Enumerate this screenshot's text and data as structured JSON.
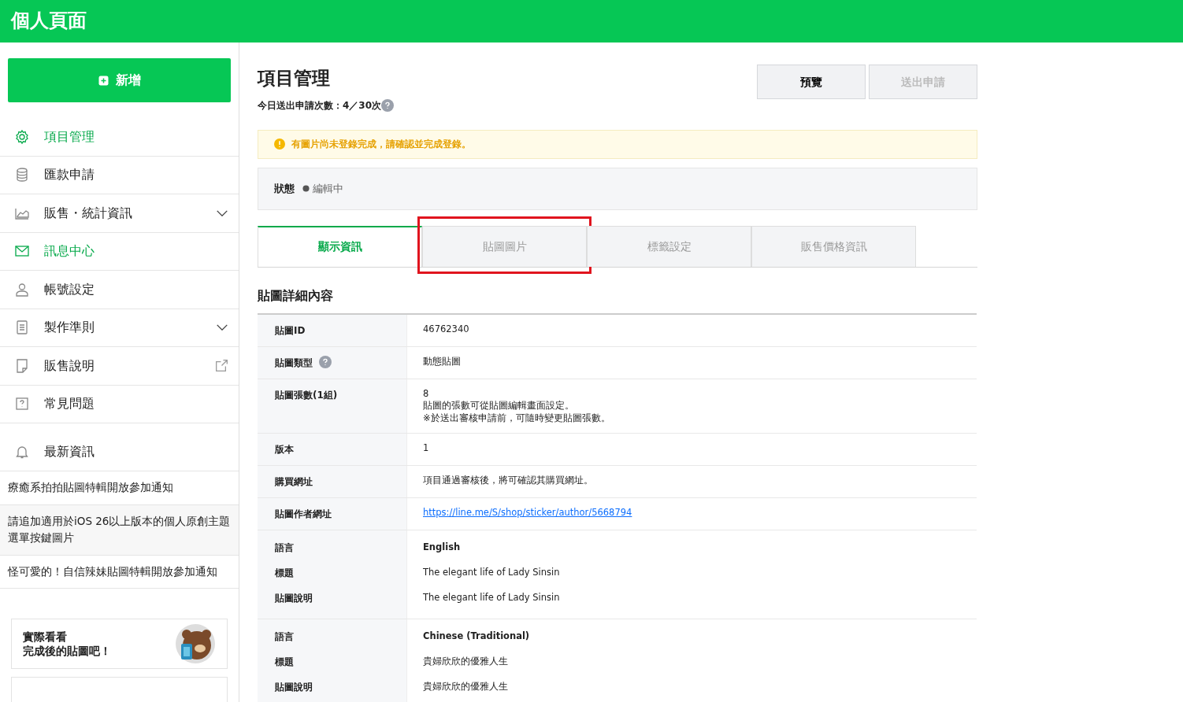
{
  "header": {
    "title": "個人頁面"
  },
  "sidebar": {
    "new_button": "新增",
    "items": [
      {
        "kind": "plain",
        "label": "項目管理",
        "highlighted": true
      },
      {
        "kind": "plain",
        "label": "匯款申請",
        "highlighted": false
      },
      {
        "kind": "expandable",
        "label": "販售・統計資訊",
        "highlighted": false
      },
      {
        "kind": "plain",
        "label": "訊息中心",
        "highlighted": true
      },
      {
        "kind": "plain",
        "label": "帳號設定",
        "highlighted": false
      },
      {
        "kind": "expandable",
        "label": "製作準則",
        "highlighted": false
      },
      {
        "kind": "external",
        "label": "販售說明",
        "highlighted": false
      },
      {
        "kind": "plain",
        "label": "常見問題",
        "highlighted": false
      }
    ],
    "news": {
      "label": "最新資訊",
      "items": [
        "療癒系拍拍貼圖特輯開放參加通知",
        "請追加適用於iOS 26以上版本的個人原創主題選單按鍵圖片",
        "怪可愛的！自信辣妹貼圖特輯開放參加通知"
      ]
    },
    "promo": {
      "lines": [
        "實際看看",
        "完成後的貼圖吧！"
      ]
    }
  },
  "main": {
    "title": "項目管理",
    "quota": "今日送出申請次數：4／30次",
    "buttons": [
      {
        "label": "預覽",
        "disabled": false
      },
      {
        "label": "送出申請",
        "disabled": true
      }
    ],
    "alert": "有圖片尚未登錄完成，請確認並完成登錄。",
    "status": {
      "label": "狀態",
      "value": "編輯中"
    },
    "tabs": [
      {
        "label": "顯示資訊",
        "selected": true,
        "marked": false
      },
      {
        "label": "貼圖圖片",
        "selected": false,
        "marked": true
      },
      {
        "label": "標籤設定",
        "selected": false,
        "marked": false
      },
      {
        "label": "販售價格資訊",
        "selected": false,
        "marked": false
      }
    ],
    "section_title": "貼圖詳細內容",
    "rows": [
      {
        "kind": "plain",
        "label": "貼圖ID",
        "help": false,
        "lines": [
          "46762340"
        ]
      },
      {
        "kind": "plain",
        "label": "貼圖類型",
        "help": true,
        "lines": [
          "動態貼圖"
        ]
      },
      {
        "kind": "plain",
        "label": "貼圖張數(1組)",
        "help": false,
        "lines": [
          "8",
          "貼圖的張數可從貼圖編輯畫面設定。",
          "※於送出審核申請前，可隨時變更貼圖張數。"
        ]
      },
      {
        "kind": "plain",
        "label": "版本",
        "help": false,
        "lines": [
          "1"
        ]
      },
      {
        "kind": "plain",
        "label": "購買網址",
        "help": false,
        "lines": [
          "項目通過審核後，將可確認其購買網址。"
        ]
      },
      {
        "kind": "link",
        "label": "貼圖作者網址",
        "url": "https://line.me/S/shop/sticker/author/5668794"
      },
      {
        "kind": "group",
        "pairs": [
          {
            "label": "語言",
            "value": "English",
            "bold": true
          },
          {
            "label": "標題",
            "value": "The elegant life of Lady Sinsin",
            "bold": false
          },
          {
            "label": "貼圖說明",
            "value": "The elegant life of Lady Sinsin",
            "bold": false
          }
        ]
      },
      {
        "kind": "group",
        "pairs": [
          {
            "label": "語言",
            "value": "Chinese (Traditional)",
            "bold": true
          },
          {
            "label": "標題",
            "value": "貴婦欣欣的優雅人生",
            "bold": false
          },
          {
            "label": "貼圖說明",
            "value": "貴婦欣欣的優雅人生",
            "bold": false
          }
        ]
      }
    ]
  }
}
